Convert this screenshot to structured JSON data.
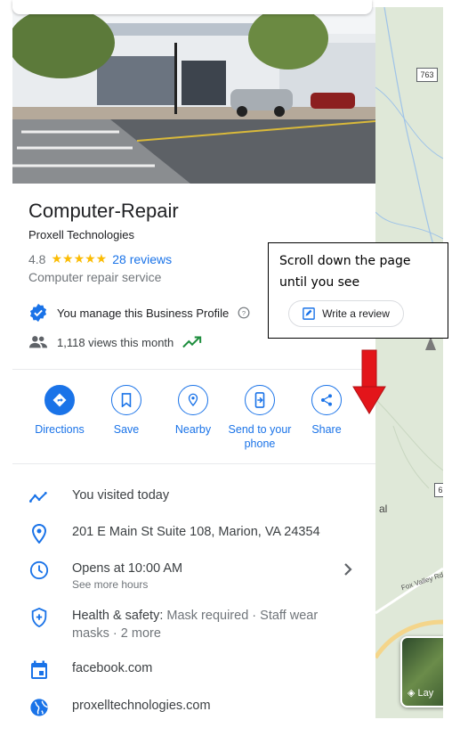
{
  "map": {
    "route_badge": "763",
    "route_badge_2": "6",
    "place_label": "al",
    "road_label": "Fox Valley Rd",
    "layers_label": "Lay"
  },
  "place": {
    "title": "Computer-Repair",
    "owner": "Proxell Technologies",
    "rating": "4.8",
    "stars": "★★★★★",
    "reviews": "28 reviews",
    "category": "Computer repair service",
    "manage_text": "You manage this Business Profile",
    "views_text": "1,118 views this month"
  },
  "actions": [
    {
      "label": "Directions",
      "icon": "directions-icon"
    },
    {
      "label": "Save",
      "icon": "bookmark-icon"
    },
    {
      "label": "Nearby",
      "icon": "nearby-icon"
    },
    {
      "label": "Send to your phone",
      "icon": "send-to-phone-icon"
    },
    {
      "label": "Share",
      "icon": "share-icon"
    }
  ],
  "info": {
    "visited": "You visited today",
    "address": "201 E Main St Suite 108, Marion, VA 24354",
    "hours": "Opens at 10:00 AM",
    "hours_more": "See more hours",
    "health_label": "Health & safety:",
    "health_detail": "Mask required · Staff wear masks · 2 more",
    "facebook": "facebook.com",
    "website": "proxelltechnologies.com"
  },
  "callout": {
    "text": "Scroll down the page\nuntil you see",
    "button_label": "Write a review"
  },
  "colors": {
    "accent": "#1a73e8",
    "star": "#fbbc04",
    "trend": "#1e8e3e",
    "arrow": "#e3151a"
  }
}
